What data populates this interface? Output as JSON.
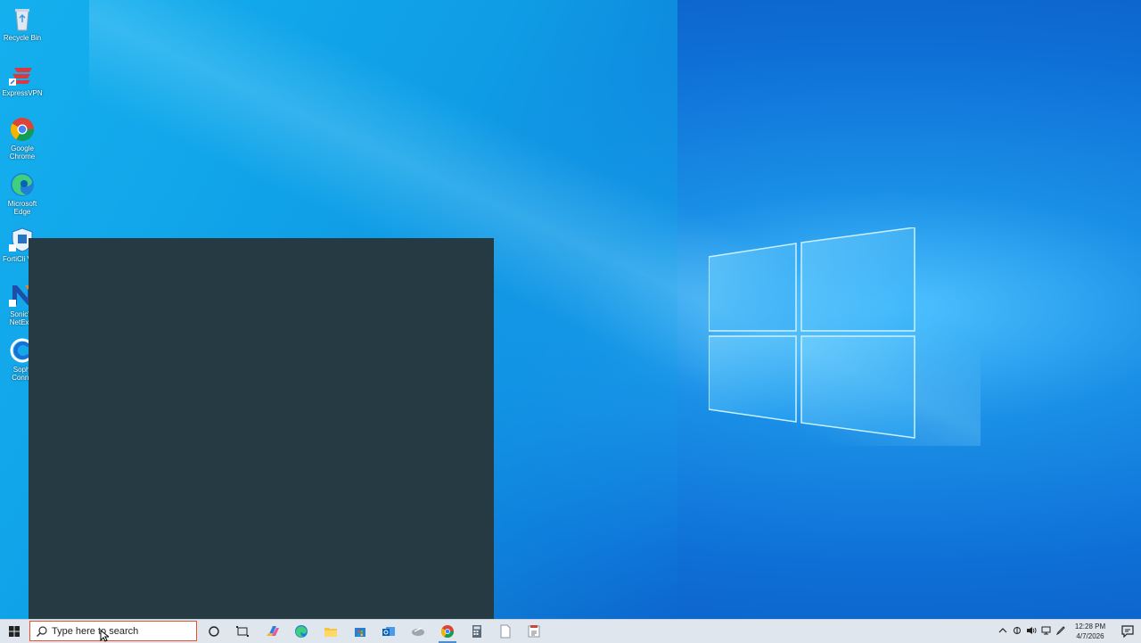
{
  "desktop": {
    "icons": [
      {
        "name": "recycle-bin",
        "label": "Recycle Bin"
      },
      {
        "name": "expressvpn",
        "label": "ExpressVPN"
      },
      {
        "name": "google-chrome",
        "label": "Google Chrome"
      },
      {
        "name": "microsoft-edge",
        "label": "Microsoft Edge"
      },
      {
        "name": "forticlient-vpn",
        "label": "FortiCli VPN"
      },
      {
        "name": "sonicwall-netextender",
        "label": "SonicW NetExte"
      },
      {
        "name": "sophos-connect",
        "label": "Sophi Conne"
      }
    ]
  },
  "taskbar": {
    "search_placeholder": "Type here to search",
    "pinned": [
      "cortana-icon",
      "task-view-icon",
      "copilot-icon",
      "edge-icon",
      "file-explorer-icon",
      "store-icon",
      "outlook-icon",
      "mail-app-icon",
      "chrome-icon",
      "calculator-icon",
      "notepad-icon",
      "document-icon"
    ],
    "active": "chrome-icon",
    "clock": {
      "time": "12:28 PM",
      "date": "4/7/2026"
    }
  },
  "colors": {
    "panel": "#253a42",
    "taskbar": "#dfe6ee",
    "search_border": "#e8522b"
  }
}
